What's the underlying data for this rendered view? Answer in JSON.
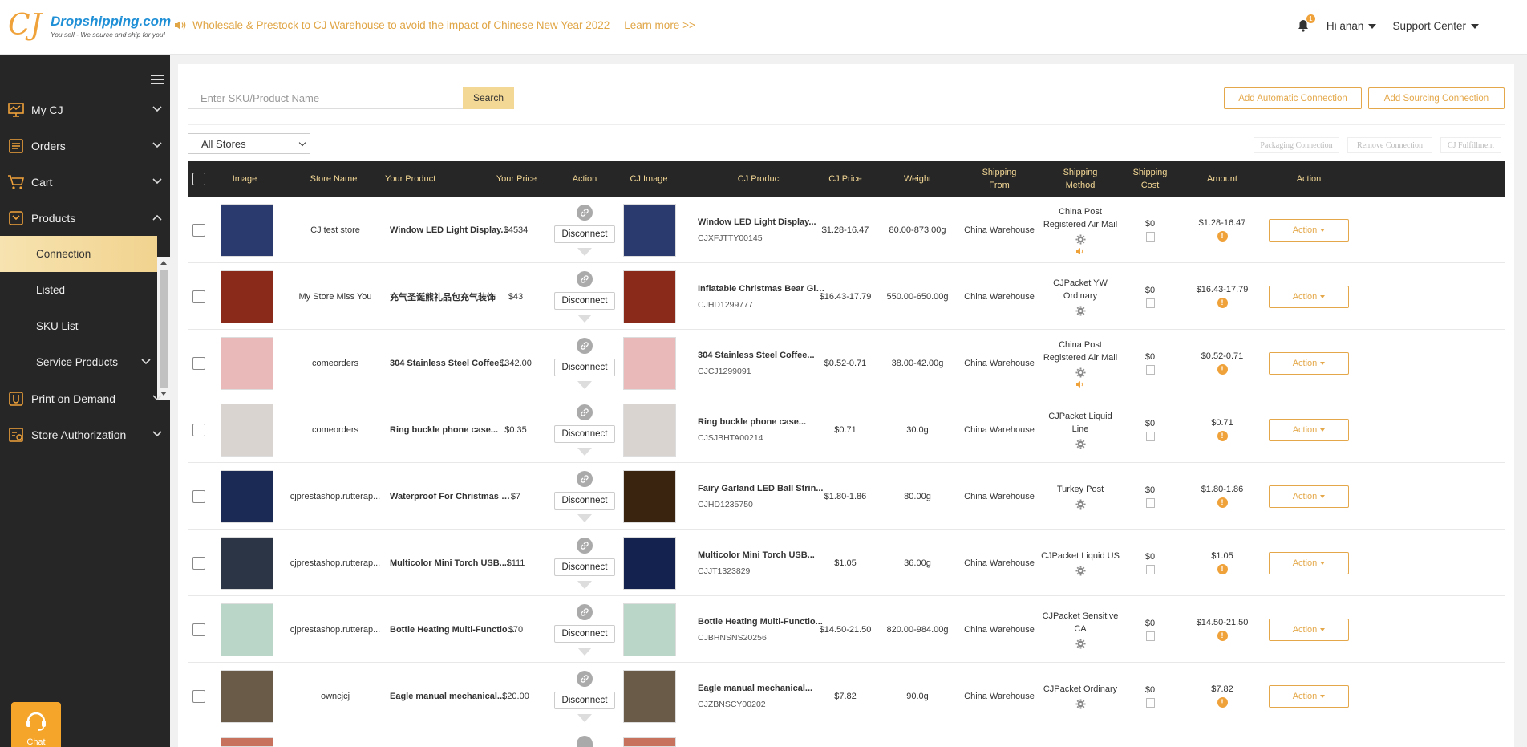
{
  "header": {
    "logo_cj": "CJ",
    "logo_brand": "Dropshipping.com",
    "logo_tagline": "You sell - We source and ship for you!",
    "notice": "Wholesale & Prestock to CJ Warehouse to avoid the impact of Chinese New Year 2022",
    "learn_more": "Learn more >>",
    "notification_count": "1",
    "user_greeting": "Hi anan",
    "support": "Support Center"
  },
  "sidebar": {
    "items": [
      {
        "label": "My CJ",
        "icon": "monitor-icon"
      },
      {
        "label": "Orders",
        "icon": "orders-icon"
      },
      {
        "label": "Cart",
        "icon": "cart-icon"
      },
      {
        "label": "Products",
        "icon": "products-icon"
      },
      {
        "label": "Print on Demand",
        "icon": "print-icon"
      },
      {
        "label": "Store Authorization",
        "icon": "store-icon"
      }
    ],
    "subitems": [
      {
        "label": "Connection"
      },
      {
        "label": "Listed"
      },
      {
        "label": "SKU List"
      },
      {
        "label": "Service Products"
      }
    ],
    "chat_label": "Chat"
  },
  "toolbar": {
    "search_placeholder": "Enter SKU/Product Name",
    "search_label": "Search",
    "add_automatic": "Add Automatic Connection",
    "add_sourcing": "Add Sourcing Connection",
    "store_filter": "All Stores",
    "packaging": "Packaging Connection",
    "remove": "Remove Connection",
    "fulfillment": "CJ Fulfillment"
  },
  "table": {
    "headers": {
      "image": "Image",
      "store": "Store Name",
      "your_product": "Your Product",
      "your_price": "Your Price",
      "action": "Action",
      "cj_image": "CJ Image",
      "cj_product": "CJ Product",
      "cj_price": "CJ Price",
      "weight": "Weight",
      "ship_from": "Shipping From",
      "ship_method": "Shipping Method",
      "ship_cost": "Shipping Cost",
      "amount": "Amount",
      "action2": "Action"
    },
    "disconnect_label": "Disconnect",
    "action_label": "Action",
    "rows": [
      {
        "store": "CJ test store",
        "product": "Window LED Light Display...",
        "price": "$4534",
        "cj_product": "Window LED Light Display...",
        "sku": "CJXFJTTY00145",
        "cj_price": "$1.28-16.47",
        "weight": "80.00-873.00g",
        "from": "China Warehouse",
        "method": "China Post Registered Air Mail",
        "cost": "$0",
        "amount": "$1.28-16.47",
        "img1": "#2a3a6e",
        "img2": "#2a3a6e"
      },
      {
        "store": "My Store Miss You",
        "product": "充气圣诞熊礼品包充气装饰",
        "price": "$43",
        "cj_product": "Inflatable Christmas Bear Gif...",
        "sku": "CJHD1299777",
        "cj_price": "$16.43-17.79",
        "weight": "550.00-650.00g",
        "from": "China Warehouse",
        "method": "CJPacket YW Ordinary",
        "cost": "$0",
        "amount": "$16.43-17.79",
        "img1": "#8a2a1a",
        "img2": "#8a2a1a"
      },
      {
        "store": "comeorders",
        "product": "304 Stainless Steel Coffee...",
        "price": "$342.00",
        "cj_product": "304 Stainless Steel Coffee...",
        "sku": "CJCJ1299091",
        "cj_price": "$0.52-0.71",
        "weight": "38.00-42.00g",
        "from": "China Warehouse",
        "method": "China Post Registered Air Mail",
        "cost": "$0",
        "amount": "$0.52-0.71",
        "img1": "#e9b8b8",
        "img2": "#e9b8b8"
      },
      {
        "store": "comeorders",
        "product": "Ring buckle phone case...",
        "price": "$0.35",
        "cj_product": "Ring buckle phone case...",
        "sku": "CJSJBHTA00214",
        "cj_price": "$0.71",
        "weight": "30.0g",
        "from": "China Warehouse",
        "method": "CJPacket Liquid Line",
        "cost": "$0",
        "amount": "$0.71",
        "img1": "#d9d4d0",
        "img2": "#d9d4d0"
      },
      {
        "store": "cjprestashop.rutterap...",
        "product": "Waterproof For Christmas Tr...",
        "price": "$7",
        "cj_product": "Fairy Garland LED Ball Strin...",
        "sku": "CJHD1235750",
        "cj_price": "$1.80-1.86",
        "weight": "80.00g",
        "from": "China Warehouse",
        "method": "Turkey Post",
        "cost": "$0",
        "amount": "$1.80-1.86",
        "img1": "#1b2a55",
        "img2": "#3a2410"
      },
      {
        "store": "cjprestashop.rutterap...",
        "product": "Multicolor Mini Torch USB...",
        "price": "$111",
        "cj_product": "Multicolor Mini Torch USB...",
        "sku": "CJJT1323829",
        "cj_price": "$1.05",
        "weight": "36.00g",
        "from": "China Warehouse",
        "method": "CJPacket Liquid US",
        "cost": "$0",
        "amount": "$1.05",
        "img1": "#2b3545",
        "img2": "#142250"
      },
      {
        "store": "cjprestashop.rutterap...",
        "product": "Bottle Heating Multi-Functio...",
        "price": "$70",
        "cj_product": "Bottle Heating Multi-Functio...",
        "sku": "CJBHNSNS20256",
        "cj_price": "$14.50-21.50",
        "weight": "820.00-984.00g",
        "from": "China Warehouse",
        "method": "CJPacket Sensitive CA",
        "cost": "$0",
        "amount": "$14.50-21.50",
        "img1": "#b9d6c9",
        "img2": "#b9d6c9"
      },
      {
        "store": "owncjcj",
        "product": "Eagle manual mechanical...",
        "price": "$20.00",
        "cj_product": "Eagle manual mechanical...",
        "sku": "CJZBNSCY00202",
        "cj_price": "$7.82",
        "weight": "90.0g",
        "from": "China Warehouse",
        "method": "CJPacket Ordinary",
        "cost": "$0",
        "amount": "$7.82",
        "img1": "#6a5a48",
        "img2": "#6a5a48"
      }
    ]
  },
  "colors": {
    "accent": "#f0a23a",
    "sidebar_bg": "#262626",
    "header_text": "#f3d795"
  }
}
